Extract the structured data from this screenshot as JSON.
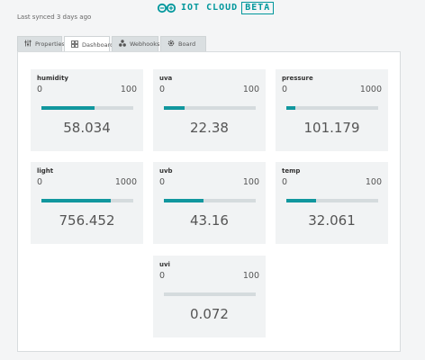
{
  "header": {
    "logo_text": "IOT CLOUD",
    "logo_badge": "BETA",
    "sync_status": "Last synced 3 days ago",
    "accent_color": "#00979c"
  },
  "tabs": [
    {
      "label": "Properties",
      "icon": "sliders-icon",
      "active": false
    },
    {
      "label": "Dashboard",
      "icon": "grid-icon",
      "active": true
    },
    {
      "label": "Webhooks",
      "icon": "webhooks-icon",
      "active": false
    },
    {
      "label": "Board",
      "icon": "chip-icon",
      "active": false
    }
  ],
  "widgets": [
    {
      "name": "humidity",
      "min": "0",
      "max": "100",
      "value": "58.034",
      "fraction": 0.58034
    },
    {
      "name": "uva",
      "min": "0",
      "max": "100",
      "value": "22.38",
      "fraction": 0.2238
    },
    {
      "name": "pressure",
      "min": "0",
      "max": "1000",
      "value": "101.179",
      "fraction": 0.101179
    },
    {
      "name": "light",
      "min": "0",
      "max": "1000",
      "value": "756.452",
      "fraction": 0.756452
    },
    {
      "name": "uvb",
      "min": "0",
      "max": "100",
      "value": "43.16",
      "fraction": 0.4316
    },
    {
      "name": "temp",
      "min": "0",
      "max": "100",
      "value": "32.061",
      "fraction": 0.32061
    },
    {
      "name": "uvi",
      "min": "0",
      "max": "100",
      "value": "0.072",
      "fraction": 0.00072
    }
  ],
  "colors": {
    "bar_fill": "#11979e",
    "bar_track": "#d5dbdd",
    "widget_bg": "#f1f3f4"
  }
}
